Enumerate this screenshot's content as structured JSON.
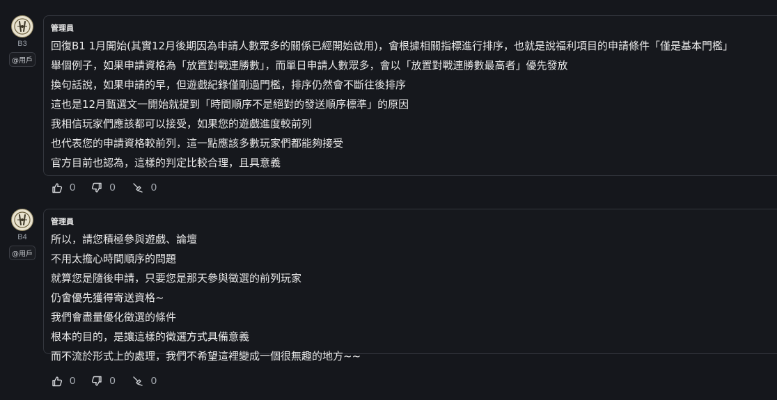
{
  "posts": [
    {
      "floor": "B3",
      "tag": "@用戶",
      "author": "管理員",
      "lines": [
        "回復B1 1月開始(其實12月後期因為申請人數眾多的關係已經開始啟用)，會根據相關指標進行排序，也就是說福利項目的申請條件「僅是基本門檻」",
        "舉個例子，如果申請資格為「放置對戰連勝數」，而單日申請人數眾多，會以「放置對戰連勝數最高者」優先發放",
        "換句話說，如果申請的早，但遊戲紀錄僅剛過門檻，排序仍然會不斷往後排序",
        "這也是12月甄選文一開始就提到「時間順序不是絕對的發送順序標準」的原因",
        "我相信玩家們應該都可以接受，如果您的遊戲進度較前列",
        "也代表您的申請資格較前列，這一點應該多數玩家們都能夠接受",
        "官方目前也認為，這樣的判定比較合理，且具意義"
      ],
      "actions": {
        "like": "0",
        "dislike": "0",
        "pin": "0"
      }
    },
    {
      "floor": "B4",
      "tag": "@用戶",
      "author": "管理員",
      "lines": [
        "所以，請您積極參與遊戲、論壇",
        "不用太擔心時間順序的問題",
        "就算您是隨後申請，只要您是那天參與徵選的前列玩家",
        "仍會優先獲得寄送資格~",
        "我們會盡量優化徵選的條件",
        "根本的目的，是讓這樣的徵選方式具備意義",
        "而不流於形式上的處理，我們不希望這裡變成一個很無趣的地方~~"
      ],
      "actions": {
        "like": "0",
        "dislike": "0",
        "pin": "0"
      }
    }
  ],
  "icons": {
    "avatar": "admin-avatar-icon",
    "like": "thumbs-up-icon",
    "dislike": "thumbs-down-icon",
    "pin": "pin-icon"
  },
  "colors": {
    "background": "#15171c",
    "text": "#e9e9e9",
    "muted": "#a7acb3",
    "border": "#34373e"
  }
}
